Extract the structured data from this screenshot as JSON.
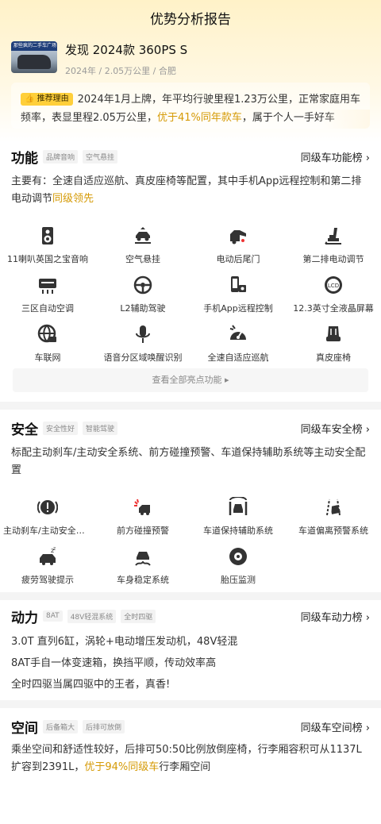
{
  "header": {
    "title": "优势分析报告"
  },
  "car": {
    "thumb_text": "那些疯的二手车广场",
    "name": "发现 2024款 360PS S",
    "meta": "2024年 / 2.05万公里 / 合肥"
  },
  "reason": {
    "tag": "推荐理由",
    "text_before": "2024年1月上牌，年平均行驶里程1.23万公里，正常家庭用车频率，表显里程2.05万公里，",
    "highlight": "优于41%同年款车",
    "text_after": "，属于个人一手好车"
  },
  "features": {
    "title": "功能",
    "chips": [
      "品牌音响",
      "空气悬挂"
    ],
    "rank_label": "同级车功能榜",
    "desc_before": "主要有：全速自适应巡航、真皮座椅等配置，其中手机App远程控制和第二排电动调节",
    "desc_highlight": "同级领先",
    "items": [
      {
        "label": "11喇叭英国之宝音响",
        "icon": "speaker-icon"
      },
      {
        "label": "空气悬挂",
        "icon": "air-suspension-icon"
      },
      {
        "label": "电动后尾门",
        "icon": "power-tailgate-icon"
      },
      {
        "label": "第二排电动调节",
        "icon": "seat-adjust-icon"
      },
      {
        "label": "三区自动空调",
        "icon": "climate-control-icon"
      },
      {
        "label": "L2辅助驾驶",
        "icon": "steering-wheel-icon"
      },
      {
        "label": "手机App远程控制",
        "icon": "phone-remote-icon"
      },
      {
        "label": "12.3英寸全液晶屏幕",
        "icon": "lcd-icon"
      },
      {
        "label": "车联网",
        "icon": "globe-icon"
      },
      {
        "label": "语音分区域唤醒识别",
        "icon": "microphone-icon"
      },
      {
        "label": "全速自适应巡航",
        "icon": "cruise-gauge-icon"
      },
      {
        "label": "真皮座椅",
        "icon": "leather-seat-icon"
      }
    ],
    "more_label": "查看全部亮点功能"
  },
  "safety": {
    "title": "安全",
    "chips": [
      "安全性好",
      "智能驾驶"
    ],
    "rank_label": "同级车安全榜",
    "desc": "标配主动刹车/主动安全系统、前方碰撞预警、车道保持辅助系统等主动安全配置",
    "items": [
      {
        "label": "主动刹车/主动安全系统",
        "icon": "brake-warning-icon"
      },
      {
        "label": "前方碰撞预警",
        "icon": "collision-warning-icon"
      },
      {
        "label": "车道保持辅助系统",
        "icon": "lane-keep-icon"
      },
      {
        "label": "车道偏离预警系统",
        "icon": "lane-departure-icon"
      },
      {
        "label": "疲劳驾驶提示",
        "icon": "fatigue-icon"
      },
      {
        "label": "车身稳定系统",
        "icon": "stability-icon"
      },
      {
        "label": "胎压监测",
        "icon": "tire-pressure-icon"
      }
    ]
  },
  "power": {
    "title": "动力",
    "chips": [
      "8AT",
      "48V轻混系统",
      "全时四驱"
    ],
    "rank_label": "同级车动力榜",
    "lines": [
      "3.0T 直列6缸，涡轮+电动增压发动机，48V轻混",
      "8AT手自一体变速箱，换挡平顺，传动效率高",
      "全时四驱当属四驱中的王者，真香!"
    ]
  },
  "space": {
    "title": "空间",
    "chips": [
      "后备箱大",
      "后排可放倒"
    ],
    "rank_label": "同级车空间榜",
    "desc_before": "乘坐空间和舒适性较好，后排可50:50比例放倒座椅，行李厢容积可从1137L扩容到2391L，",
    "desc_highlight": "优于94%同级车",
    "desc_after": "行李厢空间"
  },
  "colors": {
    "accent": "#d59a06",
    "tag_bg": "#ffcf3a",
    "header_bg": "#fff2c8"
  }
}
